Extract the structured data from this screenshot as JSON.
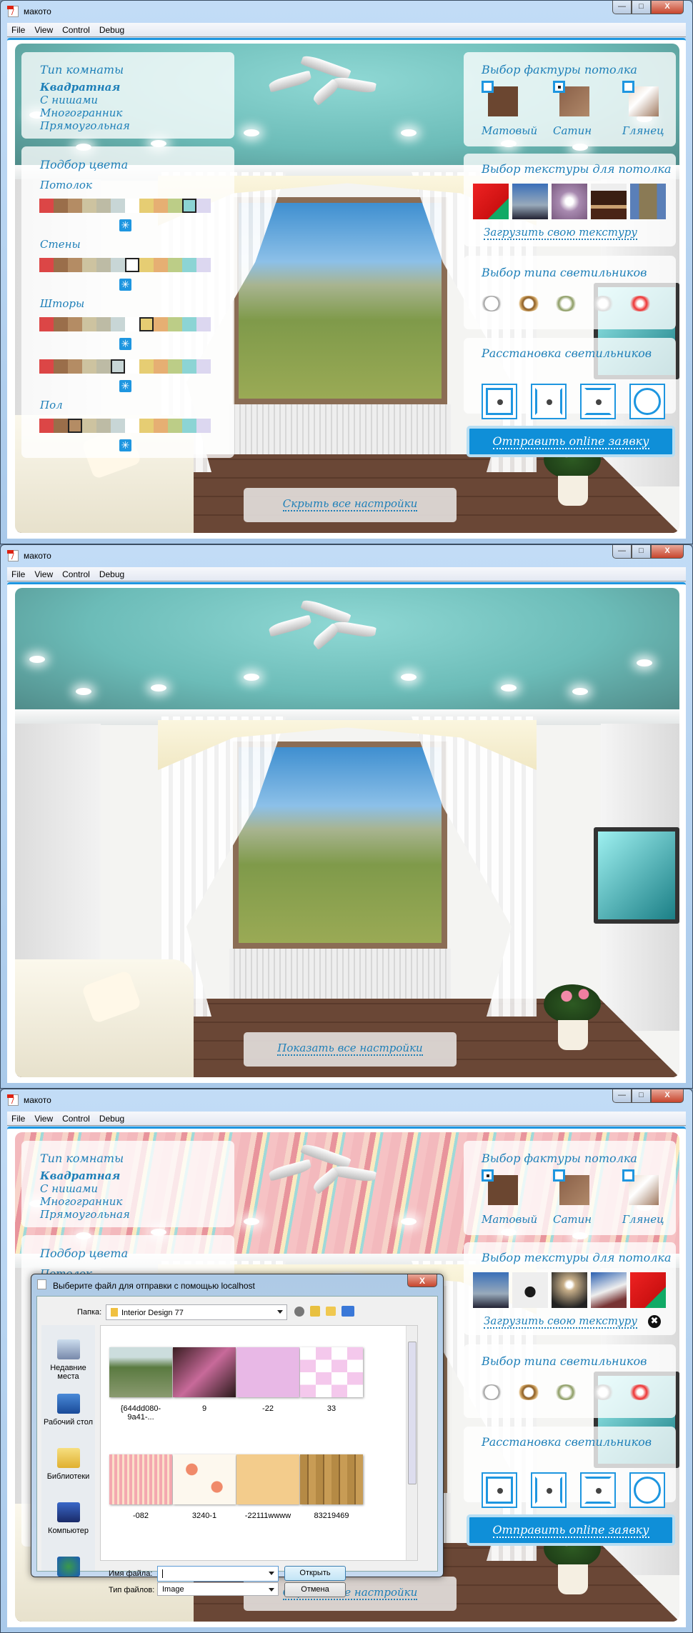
{
  "app": {
    "title": "макото",
    "menu": [
      "File",
      "View",
      "Control",
      "Debug"
    ],
    "window_buttons": {
      "minimize": "—",
      "maximize": "□",
      "close": "X"
    }
  },
  "colors": {
    "accent": "#1e96e0",
    "text": "#1d7fb8",
    "submit": "#0f8fd8",
    "ceiling_teal": "#6cbcb8"
  },
  "room_type": {
    "heading": "Тип комнаты",
    "options": [
      "Квадратная",
      "С нишами",
      "Многогранник",
      "Прямоугольная"
    ],
    "selected": 0
  },
  "color_pick": {
    "heading": "Подбор цвета",
    "palette": [
      "#dc4646",
      "#9a6e4a",
      "#b48c64",
      "#cdc3a0",
      "#bdbba5",
      "#c8d6d6",
      "#ffffff",
      "#e6cd73",
      "#e6af73",
      "#bccd87",
      "#8cd4d4",
      "#dcd7f0"
    ],
    "groups": [
      {
        "label": "Потолок",
        "rows": [
          10
        ]
      },
      {
        "label": "Стены",
        "rows": [
          6
        ]
      },
      {
        "label": "Шторы",
        "rows": [
          7,
          5
        ]
      },
      {
        "label": "Пол",
        "rows": [
          2
        ]
      }
    ],
    "picker_icon": "snowflake-icon",
    "picker_glyph": "✳"
  },
  "ceiling_finish": {
    "heading": "Выбор фактуры потолка",
    "options": [
      "Матовый",
      "Сатин",
      "Глянец"
    ]
  },
  "ceiling_texture": {
    "heading": "Выбор текстуры для потолка",
    "upload": "Загрузить свою текстуру",
    "remove_glyph": "✖"
  },
  "lamp_type": {
    "heading": "Выбор типа светильников",
    "options": [
      "chrome-ring",
      "amber-crystal",
      "star-flower",
      "crystal-white",
      "red-glass"
    ]
  },
  "lamp_layout": {
    "heading": "Расстановка светильников",
    "options": [
      "square-full",
      "sides",
      "top-bottom",
      "circle"
    ]
  },
  "submit": "Отправить online заявку",
  "windows": [
    {
      "panels": true,
      "toggle": "Скрыть все настройки",
      "ceiling": "teal",
      "finish_selected": 1,
      "textures": [
        "red-card",
        "statue-sky",
        "lilac-flower",
        "cake",
        "big-ben"
      ],
      "upload_removable": false
    },
    {
      "panels": false,
      "toggle": "Показать все настройки",
      "ceiling": "teal"
    },
    {
      "panels": true,
      "toggle": "Скрыть все настройки",
      "ceiling": "pink",
      "finish_selected": 0,
      "textures": [
        "statue-sky",
        "sushi",
        "sunset",
        "building",
        "red-card"
      ],
      "upload_removable": true
    }
  ],
  "dialog": {
    "title": "Выберите файл для отправки с помощью localhost",
    "close": "X",
    "folder_label": "Папка:",
    "folder": "Interior Design 77",
    "places": [
      "Недавние места",
      "Рабочий стол",
      "Библиотеки",
      "Компьютер",
      ""
    ],
    "files": [
      "{644dd080-9a41-...",
      "9",
      "-22",
      "33",
      "-082",
      "3240-1",
      "-22111wwww",
      "83219469"
    ],
    "filename_label": "Имя файла:",
    "filename": "",
    "filetype_label": "Тип файлов:",
    "filetype": "Image",
    "open": "Открыть",
    "cancel": "Отмена"
  }
}
